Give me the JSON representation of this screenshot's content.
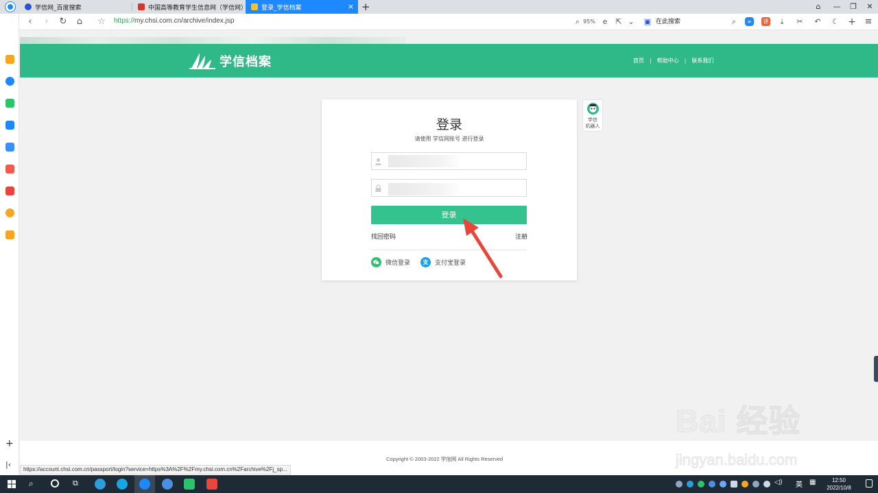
{
  "tabs": [
    {
      "label": "学信网_百度搜索",
      "icon": "baidu-paw-icon",
      "active": false
    },
    {
      "label": "中国高等教育学生信息网（学信网）",
      "icon": "chsi-flag-icon",
      "active": false
    },
    {
      "label": "登录_学信档案",
      "icon": "chsi-archive-icon",
      "active": true
    }
  ],
  "tab_close": "×",
  "new_tab": "+",
  "address": {
    "scheme": "https://",
    "rest": "my.chsi.com.cn/archive/index.jsp"
  },
  "zoom": "95%",
  "search_box": "在此搜索",
  "site": {
    "logo_text": "学信档案",
    "nav": [
      "首页",
      "帮助中心",
      "联系我们"
    ],
    "nav_sep": "|"
  },
  "login": {
    "title": "登录",
    "subtitle": "请使用 学信网账号 进行登录",
    "username_placeholder": "",
    "password_placeholder": "",
    "button": "登录",
    "forgot": "找回密码",
    "register": "注册",
    "wechat": "微信登录",
    "alipay": "支付宝登录"
  },
  "robot": {
    "label_line1": "学信",
    "label_line2": "机器人"
  },
  "footer": {
    "copyright": "Copyright © 2003-2022 学信网 All Rights Reserved"
  },
  "status_url": "https://account.chsi.com.cn/passport/login?service=https%3A%2F%2Fmy.chsi.com.cn%2Farchive%2Fj_sp...",
  "clock": {
    "time": "12:50",
    "date": "2022/10/8"
  },
  "tray_lang": "英",
  "watermark": {
    "brand": "Bai 经验",
    "url": "jingyan.baidu.com"
  },
  "colors": {
    "brand": "#2fb888",
    "button": "#34c38f",
    "tab_active": "#1e88ff",
    "arrow": "#e8453c"
  }
}
